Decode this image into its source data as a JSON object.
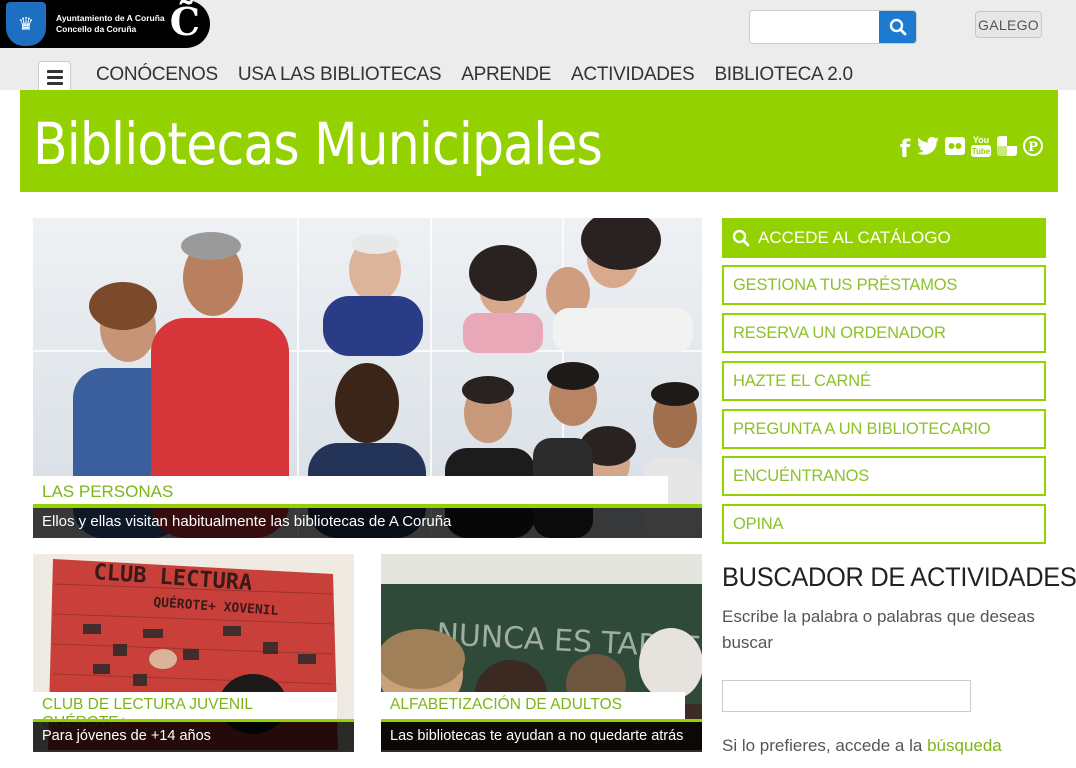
{
  "header": {
    "logo_line1": "Ayuntamiento de A Coruña",
    "logo_line2": "Concello da Coruña",
    "logo_mark": "C̃",
    "search": {
      "value": "",
      "placeholder": "",
      "icon": "search-icon"
    },
    "language_button": "GALEGO",
    "menu_icon": "hamburger-icon"
  },
  "nav": {
    "items": [
      "CONÓCENOS",
      "USA LAS BIBLIOTECAS",
      "APRENDE",
      "ACTIVIDADES",
      "BIBLIOTECA 2.0"
    ]
  },
  "banner": {
    "title": "Bibliotecas Municipales",
    "background": "#94d100",
    "social": [
      "facebook-icon",
      "twitter-icon",
      "flickr-icon",
      "youtube-icon",
      "delicious-icon",
      "pinterest-icon"
    ],
    "social_glyphs": [
      "f",
      "t",
      "●●",
      "You",
      "◧",
      "P"
    ]
  },
  "hero": {
    "title": "LAS PERSONAS",
    "description": "Ellos y ellas visitan habitualmente las bibliotecas de A Coruña"
  },
  "cards": [
    {
      "title": "CLUB DE LECTURA JUVENIL QUÉROTE+",
      "description": "Para jóvenes de +14 años"
    },
    {
      "title": "ALFABETIZACIÓN DE ADULTOS",
      "description": "Las bibliotecas te ayudan a no quedarte atrás"
    }
  ],
  "sidebar": {
    "catalog": "ACCEDE AL CATÁLOGO",
    "links": [
      "GESTIONA TUS PRÉSTAMOS",
      "RESERVA UN ORDENADOR",
      "HAZTE EL CARNÉ",
      "PREGUNTA A UN BIBLIOTECARIO",
      "ENCUÉNTRANOS",
      "OPINA"
    ]
  },
  "activity_finder": {
    "title": "BUSCADOR DE ACTIVIDADES",
    "description": "Escribe la palabra o palabras que deseas buscar",
    "input_value": "",
    "hint_prefix": "Si lo prefieres, accede a la",
    "hint_link": "búsqueda"
  },
  "colors": {
    "accent_green": "#94d100",
    "link_green": "#7cb518",
    "search_blue": "#1a7bd1"
  }
}
